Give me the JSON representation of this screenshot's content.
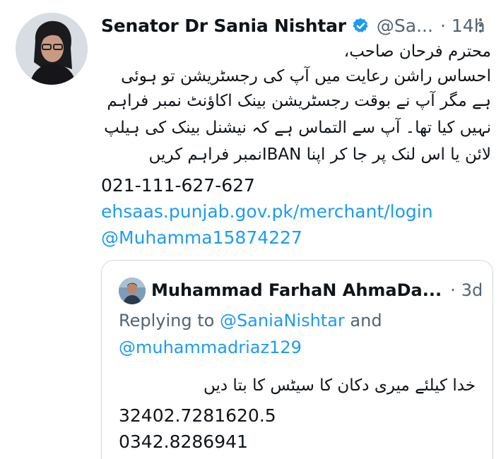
{
  "tweet": {
    "author_name": "Senator Dr Sania Nishtar",
    "handle": "@Sa...",
    "time": "14h",
    "body_urdu": [
      "محترم فرحان صاحب،",
      "احساس راشن رعایت میں آپ کی رجسٹریشن تو ہوئی",
      "ہے مگر آپ نے بوقت رجسٹریشن بینک اکاؤنٹ نمبر فراہم",
      "نہیں کیا تھا۔ آپ سے التماس ہے کہ نیشنل بینک کی ہیلپ",
      "لائن یا اس لنک پر جا کر اپنا IBANنمبر فراہم کریں"
    ],
    "phone": "021-111-627-627",
    "link": "ehsaas.punjab.gov.pk/merchant/login",
    "mention": "@Muhamma15874227"
  },
  "quoted": {
    "author_name": "Muhammad FarhaN AhmaDa...",
    "time": "3d",
    "reply_prefix": "Replying to ",
    "reply_handle_1": "@SaniaNishtar",
    "reply_and": " and",
    "reply_handle_2": "@muhammadriaz129",
    "body_urdu": "خدا کیلئے میری دکان کا سیٹس کا بتا دیں",
    "line_1": "32402.7281620.5",
    "line_2": "0342.8286941"
  },
  "icons": {
    "verified": "verified-badge-icon",
    "more": "more-options-icon"
  },
  "colors": {
    "accent": "#1d9bf0",
    "text": "#0f1419",
    "muted": "#536471",
    "border": "#cfd9de"
  }
}
